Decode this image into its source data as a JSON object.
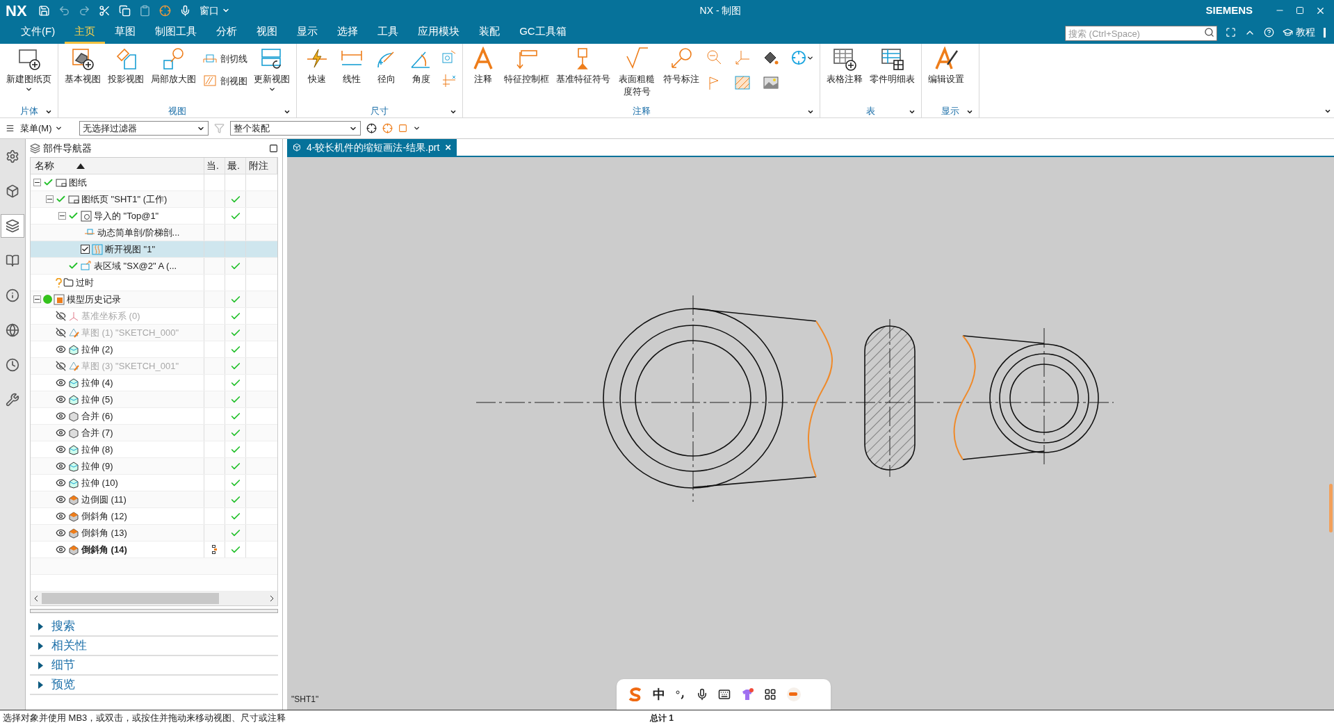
{
  "title_bar": {
    "logo": "NX",
    "window_menu": "窗口",
    "title": "NX - 制图",
    "brand": "SIEMENS"
  },
  "menu_tabs": [
    {
      "label": "文件(F)",
      "selected": false
    },
    {
      "label": "主页",
      "selected": true
    },
    {
      "label": "草图",
      "selected": false
    },
    {
      "label": "制图工具",
      "selected": false
    },
    {
      "label": "分析",
      "selected": false
    },
    {
      "label": "视图",
      "selected": false
    },
    {
      "label": "显示",
      "selected": false
    },
    {
      "label": "选择",
      "selected": false
    },
    {
      "label": "工具",
      "selected": false
    },
    {
      "label": "应用模块",
      "selected": false
    },
    {
      "label": "装配",
      "selected": false
    },
    {
      "label": "GC工具箱",
      "selected": false
    }
  ],
  "search": {
    "placeholder": "搜索 (Ctrl+Space)"
  },
  "help_link": "教程",
  "ribbon_groups": [
    {
      "name": "片体",
      "items": [
        {
          "kind": "large",
          "label": "新建图纸页",
          "dropdown": true
        }
      ]
    },
    {
      "name": "视图",
      "items": [
        {
          "kind": "large",
          "label": "基本视图",
          "dropdown": false
        },
        {
          "kind": "large",
          "label": "投影视图",
          "dropdown": false
        },
        {
          "kind": "large",
          "label": "局部放大图",
          "dropdown": false
        },
        {
          "kind": "small_pair",
          "items": [
            {
              "label": "剖切线"
            },
            {
              "label": "剖视图"
            }
          ]
        },
        {
          "kind": "large",
          "label": "更新视图",
          "dropdown": true
        }
      ]
    },
    {
      "name": "尺寸",
      "items": [
        {
          "kind": "large",
          "label": "快速",
          "dropdown": false
        },
        {
          "kind": "large",
          "label": "线性",
          "dropdown": false
        },
        {
          "kind": "large",
          "label": "径向",
          "dropdown": false
        },
        {
          "kind": "large",
          "label": "角度",
          "dropdown": false
        },
        {
          "kind": "icon_column"
        }
      ]
    },
    {
      "name": "注释",
      "items": [
        {
          "kind": "large",
          "label": "注释",
          "dropdown": false
        },
        {
          "kind": "large",
          "label": "特征控制框",
          "dropdown": false
        },
        {
          "kind": "large",
          "label": "基准特征符号",
          "dropdown": false
        },
        {
          "kind": "large",
          "label": "表面粗糙度符号",
          "dropdown": false
        },
        {
          "kind": "large",
          "label": "符号标注",
          "dropdown": false
        },
        {
          "kind": "icon_grid"
        }
      ]
    },
    {
      "name": "表",
      "items": [
        {
          "kind": "large",
          "label": "表格注释",
          "dropdown": false
        },
        {
          "kind": "large",
          "label": "零件明细表",
          "dropdown": false
        }
      ]
    },
    {
      "name": "显示",
      "items": [
        {
          "kind": "large",
          "label": "编辑设置",
          "dropdown": false
        }
      ]
    }
  ],
  "selection_bar": {
    "menu": "菜单(M)",
    "filter": "无选择过滤器",
    "scope": "整个装配"
  },
  "side_tabs": [
    {
      "selected": false
    },
    {
      "selected": false
    },
    {
      "selected": true
    },
    {
      "selected": false
    },
    {
      "selected": false
    },
    {
      "selected": false
    },
    {
      "selected": false
    },
    {
      "selected": false
    }
  ],
  "navigator": {
    "title": "部件导航器",
    "columns": [
      "名称",
      "当.",
      "最.",
      "附注"
    ],
    "tree": [
      {
        "label": "图纸",
        "kind": "drawing",
        "checked": true,
        "up_to_date": false,
        "selected": false,
        "expanded": true,
        "children": [
          {
            "label": "图纸页 \"SHT1\" (工作)",
            "kind": "sheet",
            "checked": true,
            "up_to_date": true,
            "selected": false,
            "expanded": true,
            "children": [
              {
                "label": "导入的 \"Top@1\"",
                "kind": "view",
                "checked": true,
                "up_to_date": true,
                "selected": false,
                "expanded": true,
                "children": [
                  {
                    "label": "动态简单剖/阶梯剖...",
                    "kind": "section",
                    "checked": false,
                    "up_to_date": false,
                    "selected": false
                  },
                  {
                    "label": "断开视图 \"1\"",
                    "kind": "break",
                    "checked": true,
                    "up_to_date": false,
                    "selected": true
                  }
                ]
              },
              {
                "label": "表区域 \"SX@2\" A (...",
                "kind": "table_region",
                "checked": true,
                "up_to_date": true,
                "selected": false
              }
            ]
          },
          {
            "label": "过时",
            "kind": "outdated",
            "up_to_date": false,
            "selected": false
          }
        ]
      },
      {
        "label": "模型历史记录",
        "kind": "history",
        "up_to_date": true,
        "selected": false,
        "expanded": true,
        "children": [
          {
            "label": "基准坐标系 (0)",
            "kind": "csys",
            "visible": false,
            "up_to_date": true,
            "selected": false,
            "current": false
          },
          {
            "label": "草图 (1) \"SKETCH_000\"",
            "kind": "sketch",
            "visible": false,
            "up_to_date": true,
            "selected": false,
            "current": false
          },
          {
            "label": "拉伸 (2)",
            "kind": "extrude",
            "visible": true,
            "up_to_date": true,
            "selected": false,
            "current": false
          },
          {
            "label": "草图 (3) \"SKETCH_001\"",
            "kind": "sketch",
            "visible": false,
            "up_to_date": true,
            "selected": false,
            "current": false
          },
          {
            "label": "拉伸 (4)",
            "kind": "extrude",
            "visible": true,
            "up_to_date": true,
            "selected": false,
            "current": false
          },
          {
            "label": "拉伸 (5)",
            "kind": "extrude",
            "visible": true,
            "up_to_date": true,
            "selected": false,
            "current": false
          },
          {
            "label": "合并 (6)",
            "kind": "unite",
            "visible": true,
            "up_to_date": true,
            "selected": false,
            "current": false
          },
          {
            "label": "合并 (7)",
            "kind": "unite",
            "visible": true,
            "up_to_date": true,
            "selected": false,
            "current": false
          },
          {
            "label": "拉伸 (8)",
            "kind": "extrude",
            "visible": true,
            "up_to_date": true,
            "selected": false,
            "current": false
          },
          {
            "label": "拉伸 (9)",
            "kind": "extrude",
            "visible": true,
            "up_to_date": true,
            "selected": false,
            "current": false
          },
          {
            "label": "拉伸 (10)",
            "kind": "extrude",
            "visible": true,
            "up_to_date": true,
            "selected": false,
            "current": false
          },
          {
            "label": "边倒圆 (11)",
            "kind": "blend",
            "visible": true,
            "up_to_date": true,
            "selected": false,
            "current": false
          },
          {
            "label": "倒斜角 (12)",
            "kind": "chamfer",
            "visible": true,
            "up_to_date": true,
            "selected": false,
            "current": false
          },
          {
            "label": "倒斜角 (13)",
            "kind": "chamfer",
            "visible": true,
            "up_to_date": true,
            "selected": false,
            "current": false
          },
          {
            "label": "倒斜角 (14)",
            "kind": "chamfer",
            "visible": true,
            "up_to_date": true,
            "selected": false,
            "current": true
          }
        ]
      }
    ],
    "sections": [
      {
        "label": "搜索",
        "expanded": false
      },
      {
        "label": "相关性",
        "expanded": false
      },
      {
        "label": "细节",
        "expanded": false
      },
      {
        "label": "预览",
        "expanded": false
      }
    ]
  },
  "document_tab": {
    "label": "4-较长机件的缩短画法-结果.prt",
    "close": "×"
  },
  "canvas": {
    "sheet_label": "\"SHT1\""
  },
  "ime_bar": {
    "mode": "中"
  },
  "status_bar": {
    "prompt": "选择对象并使用 MB3，或双击，或按住并拖动来移动视图、尺寸或注释",
    "total": "总计 1"
  }
}
